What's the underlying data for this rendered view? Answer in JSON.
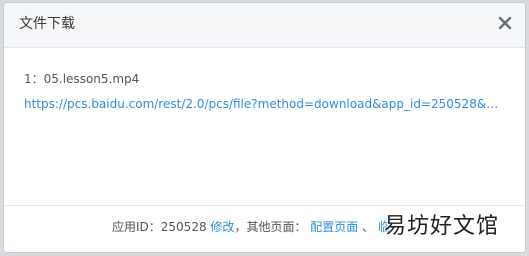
{
  "dialog": {
    "title": "文件下载",
    "close_icon": "close-icon"
  },
  "file": {
    "index": "1：",
    "name": "05.lesson5.mp4",
    "url": "https://pcs.baidu.com/rest/2.0/pcs/file?method=download&app_id=250528&file..."
  },
  "footer": {
    "app_id_label": "应用ID：250528",
    "modify_link": "修改",
    "other_pages_label": "，其他页面：",
    "config_link": "配置页面",
    "separator": "、",
    "temp_link": "临"
  },
  "watermark": "易坊好文馆",
  "colors": {
    "link": "#2e8ee0",
    "header_bg": "#f5f6f8"
  }
}
